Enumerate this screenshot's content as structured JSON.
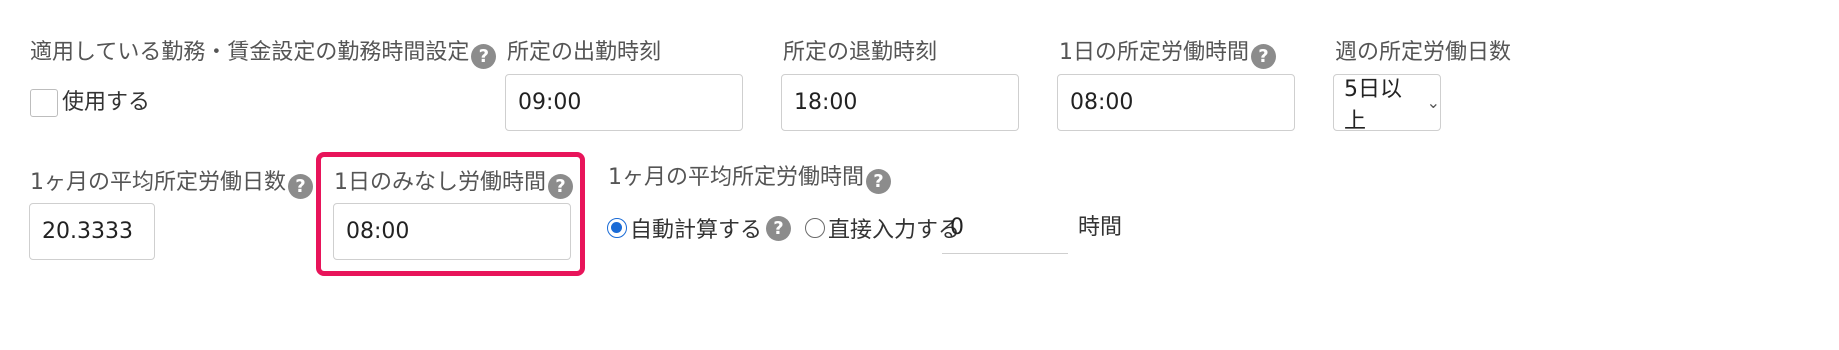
{
  "colors": {
    "highlight": "#e8145a",
    "radio_accent": "#1a6bd6",
    "help_icon": "#8c8c8c"
  },
  "work_time_setting": {
    "label": "適用している勤務・賃金設定の勤務時間設定",
    "checkbox_label": "使用する",
    "checked": false,
    "help_icon": "question-circle-icon"
  },
  "start_time": {
    "label": "所定の出勤時刻",
    "value": "09:00"
  },
  "end_time": {
    "label": "所定の退勤時刻",
    "value": "18:00"
  },
  "daily_hours": {
    "label": "1日の所定労働時間",
    "value": "08:00",
    "help_icon": "question-circle-icon"
  },
  "weekly_days": {
    "label": "週の所定労働日数",
    "selected": "5日以上",
    "chevron": "chevron-down-icon"
  },
  "monthly_avg_days": {
    "label": "1ヶ月の平均所定労働日数",
    "value": "20.3333",
    "help_icon": "question-circle-icon"
  },
  "deemed_hours": {
    "label": "1日のみなし労働時間",
    "value": "08:00",
    "help_icon": "question-circle-icon"
  },
  "monthly_avg_hours": {
    "label": "1ヶ月の平均所定労働時間",
    "help_icon": "question-circle-icon",
    "option_auto": "自動計算する",
    "option_manual": "直接入力する",
    "selected": "auto",
    "manual_value": "0",
    "unit": "時間"
  }
}
